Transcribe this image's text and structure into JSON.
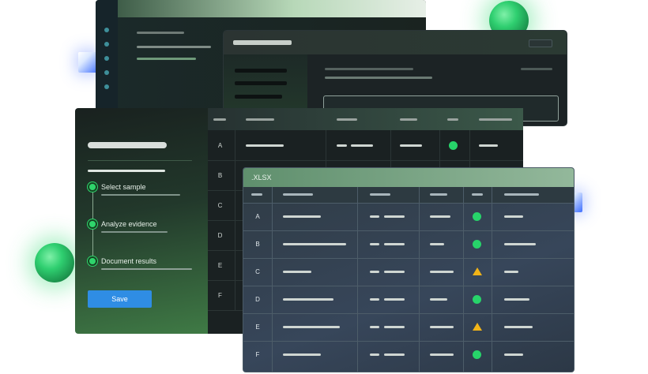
{
  "workflow": {
    "steps": [
      {
        "label": "Select sample"
      },
      {
        "label": "Analyze evidence"
      },
      {
        "label": "Document results"
      }
    ],
    "save_label": "Save"
  },
  "back_table": {
    "rows": [
      "A",
      "B",
      "C",
      "D",
      "E",
      "F"
    ]
  },
  "xlsx_window": {
    "title": ".XLSX",
    "rows": [
      {
        "id": "A",
        "status": "ok"
      },
      {
        "id": "B",
        "status": "ok"
      },
      {
        "id": "C",
        "status": "warning"
      },
      {
        "id": "D",
        "status": "ok"
      },
      {
        "id": "E",
        "status": "warning"
      },
      {
        "id": "F",
        "status": "ok"
      }
    ]
  },
  "colors": {
    "accent": "#2f8de4",
    "status_ok": "#27d46a",
    "status_warning": "#f2b418",
    "orb": "#2fcf70"
  }
}
